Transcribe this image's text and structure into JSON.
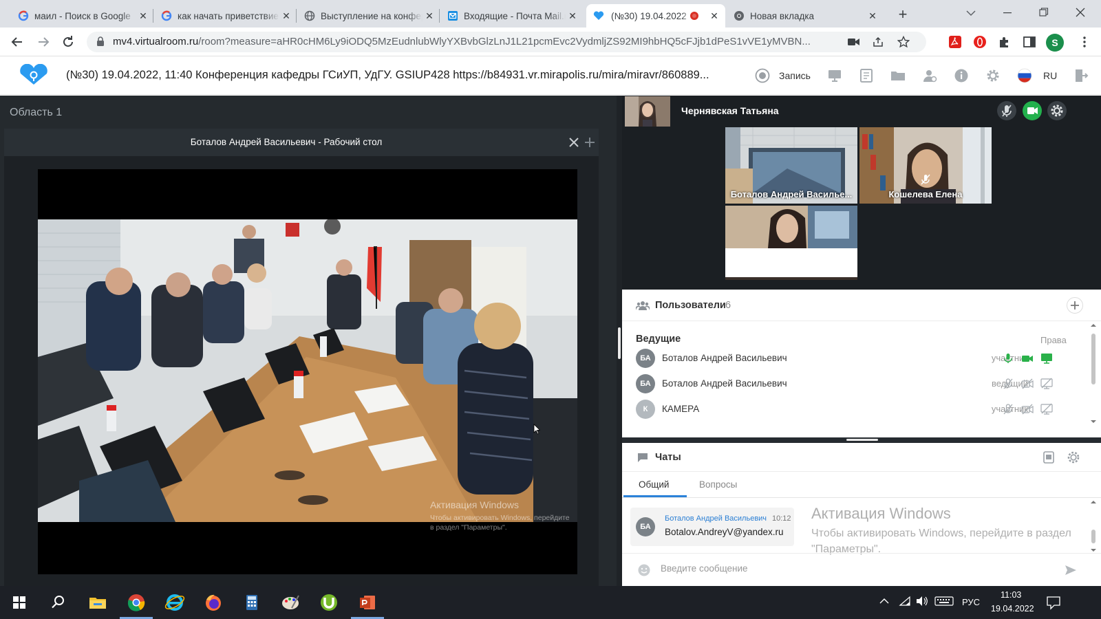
{
  "browser": {
    "tabs": [
      {
        "label": "маил - Поиск в Google",
        "icon": "google-icon",
        "active": false
      },
      {
        "label": "как начать приветствие",
        "icon": "google-icon",
        "active": false
      },
      {
        "label": "Выступление на конференции",
        "icon": "globe-icon",
        "active": false
      },
      {
        "label": "Входящие - Почта Mail.ru",
        "icon": "mail-icon",
        "active": false
      },
      {
        "label": "(№30) 19.04.2022",
        "icon": "mirapolis-icon",
        "active": true,
        "recording": true
      },
      {
        "label": "Новая вкладка",
        "icon": "chrome-icon",
        "active": false
      }
    ],
    "url_host": "mv4.virtualroom.ru",
    "url_rest": "/room?measure=aHR0cHM6Ly9iODQ5MzEudnlubWlyYXBvbGlzLnJ1L21pcmEvc2VydmljZS92MI9hbHQ5cFJjb1dPeS1vVE1yMVBN...",
    "profile_initial": "S"
  },
  "app": {
    "title": "(№30) 19.04.2022, 11:40 Конференция кафедры ГСиУП, УдГУ. GSIUP428 https://b84931.vr.mirapolis.ru/mira/miravr/860889...",
    "record_label": "Запись",
    "language": "RU",
    "accent_color": "#2b9bf0"
  },
  "left_area": {
    "area_title": "Область 1",
    "panel_title": "Боталов Андрей Васильевич - Рабочий стол",
    "watermark_title": "Активация Windows",
    "watermark_text": "Чтобы активировать Windows, перейдите в раздел \"Параметры\"."
  },
  "video_dock": {
    "self_name": "Чернявская Татьяна",
    "tiles": [
      {
        "name": "Боталов Андрей Василье..."
      },
      {
        "name": "Кошелева Елена"
      },
      {
        "name": ""
      }
    ]
  },
  "users": {
    "title": "Пользователи",
    "count": "6",
    "group": "Ведущие",
    "rights_label": "Права",
    "rows": [
      {
        "initials": "БА",
        "name": "Боталов Андрей Васильевич",
        "role": "участник",
        "mic": "on",
        "cam": "on",
        "screen": "on"
      },
      {
        "initials": "БА",
        "name": "Боталов Андрей Васильевич",
        "role": "ведущий",
        "mic": "off",
        "cam": "off",
        "screen": "off"
      },
      {
        "initials": "К",
        "name": "КАМЕРА",
        "role": "участник",
        "mic": "off",
        "cam": "off",
        "screen": "off"
      }
    ]
  },
  "chats": {
    "title": "Чаты",
    "tabs": [
      "Общий",
      "Вопросы"
    ],
    "message": {
      "initials": "БА",
      "author": "Боталов Андрей Васильевич",
      "time": "10:12",
      "text": "Botalov.AndreyV@yandex.ru"
    },
    "watermark_title": "Активация Windows",
    "watermark_text": "Чтобы активировать Windows, перейдите в раздел \"Параметры\".",
    "input_placeholder": "Введите сообщение"
  },
  "taskbar": {
    "apps": [
      "windows-start-icon",
      "search-icon",
      "file-explorer-icon",
      "chrome-icon",
      "internet-explorer-icon",
      "firefox-icon",
      "calculator-icon",
      "paint-icon",
      "utorrent-icon",
      "powerpoint-icon"
    ],
    "language": "РУС",
    "time": "11:03",
    "date": "19.04.2022"
  }
}
